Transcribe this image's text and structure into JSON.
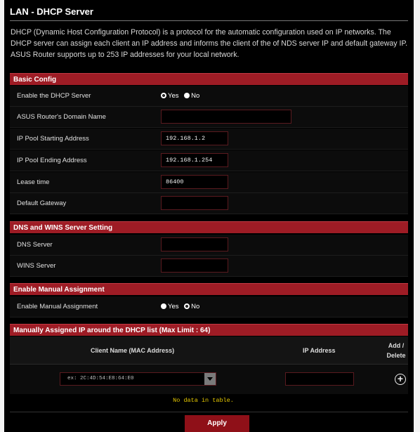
{
  "page": {
    "title": "LAN - DHCP Server",
    "description": "DHCP (Dynamic Host Configuration Protocol) is a protocol for the automatic configuration used on IP networks. The DHCP server can assign each client an IP address and informs the client of the of NDS server IP and default gateway IP. ASUS Router supports up to 253 IP addresses for your local network."
  },
  "basic": {
    "header": "Basic Config",
    "enable_label": "Enable the DHCP Server",
    "enable_yes": "Yes",
    "enable_no": "No",
    "enable_selected": "Yes",
    "domain_label": "ASUS Router's Domain Name",
    "domain_value": "",
    "start_label": "IP Pool Starting Address",
    "start_value": "192.168.1.2",
    "end_label": "IP Pool Ending Address",
    "end_value": "192.168.1.254",
    "lease_label": "Lease time",
    "lease_value": "86400",
    "gateway_label": "Default Gateway",
    "gateway_value": ""
  },
  "dns": {
    "header": "DNS and WINS Server Setting",
    "dns_label": "DNS Server",
    "dns_value": "",
    "wins_label": "WINS Server",
    "wins_value": ""
  },
  "manual": {
    "header": "Enable Manual Assignment",
    "label": "Enable Manual Assignment",
    "yes": "Yes",
    "no": "No",
    "selected": "No"
  },
  "list": {
    "header": "Manually Assigned IP around the DHCP list (Max Limit : 64)",
    "col_client": "Client Name (MAC Address)",
    "col_ip": "IP Address",
    "col_add": "Add / Delete",
    "mac_placeholder": "ex: 2C:4D:54:E8:64:E0",
    "empty": "No data in table."
  },
  "apply_label": "Apply",
  "colors": {
    "accent": "#9e1c25",
    "button": "#8f1018",
    "nodata": "#e6c800"
  }
}
